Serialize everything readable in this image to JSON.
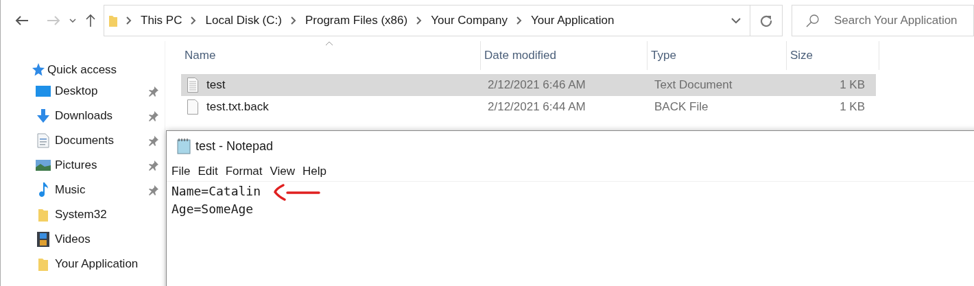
{
  "navigation": {
    "back": {
      "disabled": false
    },
    "forward": {
      "disabled": true
    }
  },
  "address_bar": {
    "path": [
      "This PC",
      "Local Disk (C:)",
      "Program Files (x86)",
      "Your Company",
      "Your Application"
    ]
  },
  "search": {
    "placeholder": "Search Your Application"
  },
  "sidebar": {
    "header": "Quick access",
    "items": [
      {
        "label": "Desktop",
        "kind": "desktop",
        "pinned": true
      },
      {
        "label": "Downloads",
        "kind": "downloads",
        "pinned": true
      },
      {
        "label": "Documents",
        "kind": "documents",
        "pinned": true
      },
      {
        "label": "Pictures",
        "kind": "pictures",
        "pinned": true
      },
      {
        "label": "Music",
        "kind": "music",
        "pinned": true
      },
      {
        "label": "System32",
        "kind": "folder",
        "pinned": false
      },
      {
        "label": "Videos",
        "kind": "videos",
        "pinned": false
      },
      {
        "label": "Your Application",
        "kind": "folder",
        "pinned": false
      }
    ]
  },
  "file_list": {
    "columns": [
      "Name",
      "Date modified",
      "Type",
      "Size"
    ],
    "rows": [
      {
        "name": "test",
        "date_modified": "2/12/2021 6:46 AM",
        "type": "Text Document",
        "size": "1 KB",
        "selected": true,
        "kind": "text"
      },
      {
        "name": "test.txt.back",
        "date_modified": "2/12/2021 6:44 AM",
        "type": "BACK File",
        "size": "1 KB",
        "selected": false,
        "kind": "blank"
      }
    ]
  },
  "notepad": {
    "title": "test - Notepad",
    "menu": [
      "File",
      "Edit",
      "Format",
      "View",
      "Help"
    ],
    "lines": [
      "Name=Catalin",
      "Age=SomeAge"
    ]
  }
}
